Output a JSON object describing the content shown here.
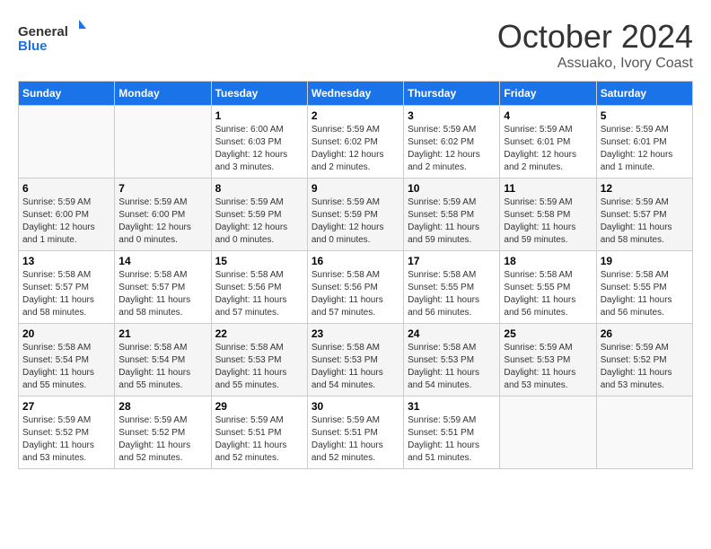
{
  "logo": {
    "line1": "General",
    "line2": "Blue"
  },
  "title": "October 2024",
  "subtitle": "Assuako, Ivory Coast",
  "days_of_week": [
    "Sunday",
    "Monday",
    "Tuesday",
    "Wednesday",
    "Thursday",
    "Friday",
    "Saturday"
  ],
  "weeks": [
    [
      {
        "day": "",
        "info": ""
      },
      {
        "day": "",
        "info": ""
      },
      {
        "day": "1",
        "info": "Sunrise: 6:00 AM\nSunset: 6:03 PM\nDaylight: 12 hours\nand 3 minutes."
      },
      {
        "day": "2",
        "info": "Sunrise: 5:59 AM\nSunset: 6:02 PM\nDaylight: 12 hours\nand 2 minutes."
      },
      {
        "day": "3",
        "info": "Sunrise: 5:59 AM\nSunset: 6:02 PM\nDaylight: 12 hours\nand 2 minutes."
      },
      {
        "day": "4",
        "info": "Sunrise: 5:59 AM\nSunset: 6:01 PM\nDaylight: 12 hours\nand 2 minutes."
      },
      {
        "day": "5",
        "info": "Sunrise: 5:59 AM\nSunset: 6:01 PM\nDaylight: 12 hours\nand 1 minute."
      }
    ],
    [
      {
        "day": "6",
        "info": "Sunrise: 5:59 AM\nSunset: 6:00 PM\nDaylight: 12 hours\nand 1 minute."
      },
      {
        "day": "7",
        "info": "Sunrise: 5:59 AM\nSunset: 6:00 PM\nDaylight: 12 hours\nand 0 minutes."
      },
      {
        "day": "8",
        "info": "Sunrise: 5:59 AM\nSunset: 5:59 PM\nDaylight: 12 hours\nand 0 minutes."
      },
      {
        "day": "9",
        "info": "Sunrise: 5:59 AM\nSunset: 5:59 PM\nDaylight: 12 hours\nand 0 minutes."
      },
      {
        "day": "10",
        "info": "Sunrise: 5:59 AM\nSunset: 5:58 PM\nDaylight: 11 hours\nand 59 minutes."
      },
      {
        "day": "11",
        "info": "Sunrise: 5:59 AM\nSunset: 5:58 PM\nDaylight: 11 hours\nand 59 minutes."
      },
      {
        "day": "12",
        "info": "Sunrise: 5:59 AM\nSunset: 5:57 PM\nDaylight: 11 hours\nand 58 minutes."
      }
    ],
    [
      {
        "day": "13",
        "info": "Sunrise: 5:58 AM\nSunset: 5:57 PM\nDaylight: 11 hours\nand 58 minutes."
      },
      {
        "day": "14",
        "info": "Sunrise: 5:58 AM\nSunset: 5:57 PM\nDaylight: 11 hours\nand 58 minutes."
      },
      {
        "day": "15",
        "info": "Sunrise: 5:58 AM\nSunset: 5:56 PM\nDaylight: 11 hours\nand 57 minutes."
      },
      {
        "day": "16",
        "info": "Sunrise: 5:58 AM\nSunset: 5:56 PM\nDaylight: 11 hours\nand 57 minutes."
      },
      {
        "day": "17",
        "info": "Sunrise: 5:58 AM\nSunset: 5:55 PM\nDaylight: 11 hours\nand 56 minutes."
      },
      {
        "day": "18",
        "info": "Sunrise: 5:58 AM\nSunset: 5:55 PM\nDaylight: 11 hours\nand 56 minutes."
      },
      {
        "day": "19",
        "info": "Sunrise: 5:58 AM\nSunset: 5:55 PM\nDaylight: 11 hours\nand 56 minutes."
      }
    ],
    [
      {
        "day": "20",
        "info": "Sunrise: 5:58 AM\nSunset: 5:54 PM\nDaylight: 11 hours\nand 55 minutes."
      },
      {
        "day": "21",
        "info": "Sunrise: 5:58 AM\nSunset: 5:54 PM\nDaylight: 11 hours\nand 55 minutes."
      },
      {
        "day": "22",
        "info": "Sunrise: 5:58 AM\nSunset: 5:53 PM\nDaylight: 11 hours\nand 55 minutes."
      },
      {
        "day": "23",
        "info": "Sunrise: 5:58 AM\nSunset: 5:53 PM\nDaylight: 11 hours\nand 54 minutes."
      },
      {
        "day": "24",
        "info": "Sunrise: 5:58 AM\nSunset: 5:53 PM\nDaylight: 11 hours\nand 54 minutes."
      },
      {
        "day": "25",
        "info": "Sunrise: 5:59 AM\nSunset: 5:53 PM\nDaylight: 11 hours\nand 53 minutes."
      },
      {
        "day": "26",
        "info": "Sunrise: 5:59 AM\nSunset: 5:52 PM\nDaylight: 11 hours\nand 53 minutes."
      }
    ],
    [
      {
        "day": "27",
        "info": "Sunrise: 5:59 AM\nSunset: 5:52 PM\nDaylight: 11 hours\nand 53 minutes."
      },
      {
        "day": "28",
        "info": "Sunrise: 5:59 AM\nSunset: 5:52 PM\nDaylight: 11 hours\nand 52 minutes."
      },
      {
        "day": "29",
        "info": "Sunrise: 5:59 AM\nSunset: 5:51 PM\nDaylight: 11 hours\nand 52 minutes."
      },
      {
        "day": "30",
        "info": "Sunrise: 5:59 AM\nSunset: 5:51 PM\nDaylight: 11 hours\nand 52 minutes."
      },
      {
        "day": "31",
        "info": "Sunrise: 5:59 AM\nSunset: 5:51 PM\nDaylight: 11 hours\nand 51 minutes."
      },
      {
        "day": "",
        "info": ""
      },
      {
        "day": "",
        "info": ""
      }
    ]
  ]
}
